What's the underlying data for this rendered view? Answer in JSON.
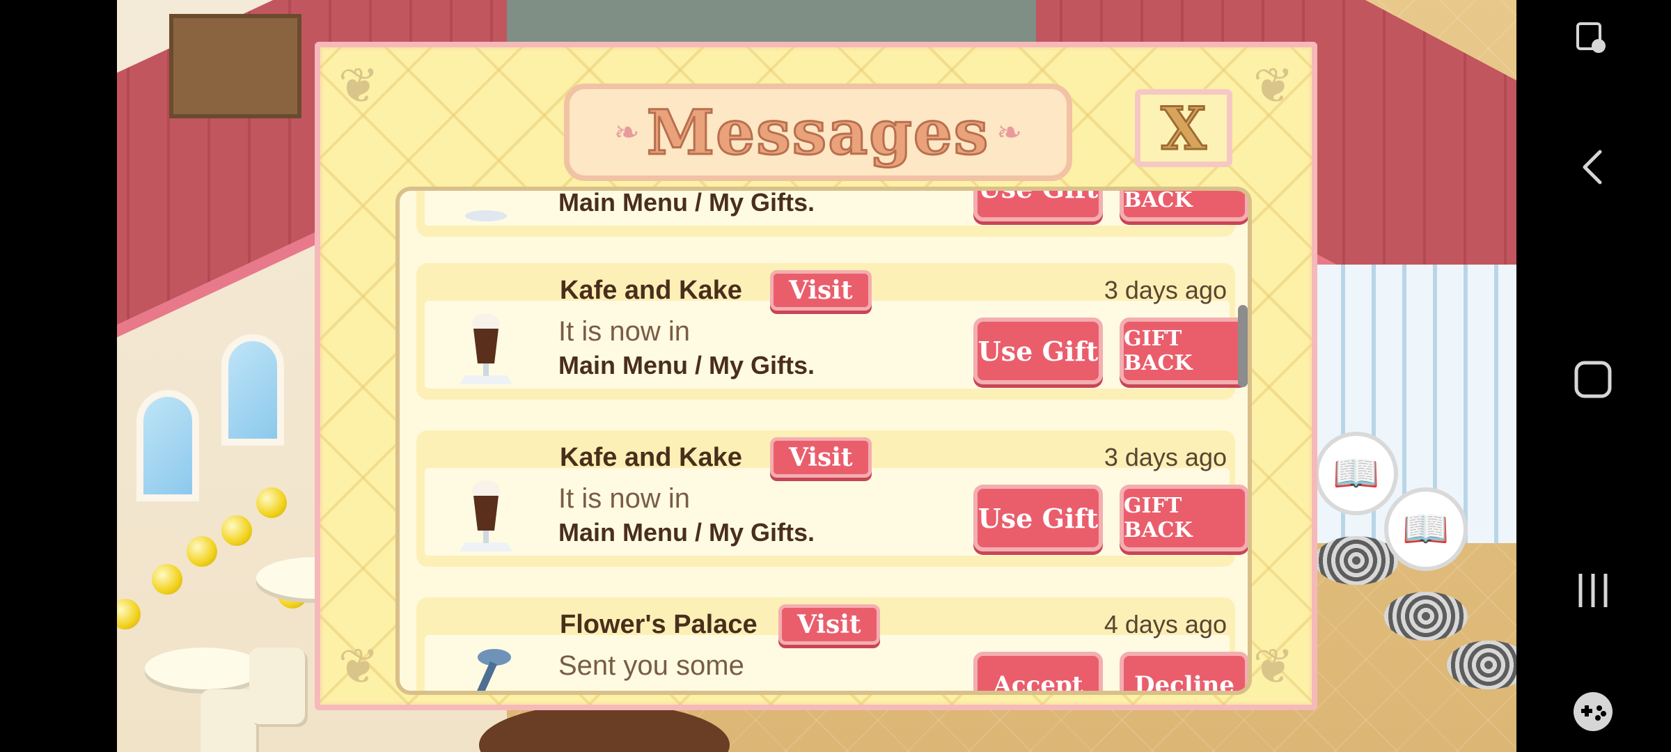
{
  "dialog": {
    "title": "Messages",
    "close_label": "X"
  },
  "messages": [
    {
      "sender": "",
      "time": "",
      "line1": "",
      "line2": "Main Menu / My Gifts.",
      "primary_action": "Use Gift",
      "secondary_action": "GIFT BACK",
      "icon": "gift-icon",
      "partially_visible": true
    },
    {
      "sender": "Kafe and Kake",
      "visit_label": "Visit",
      "time": "3 days ago",
      "line1": "It is now in",
      "line2": "Main Menu / My Gifts.",
      "primary_action": "Use Gift",
      "secondary_action": "GIFT BACK",
      "icon": "iced-coffee-icon"
    },
    {
      "sender": "Kafe and Kake",
      "visit_label": "Visit",
      "time": "3 days ago",
      "line1": "It is now in",
      "line2": "Main Menu / My Gifts.",
      "primary_action": "Use Gift",
      "secondary_action": "GIFT BACK",
      "icon": "iced-coffee-icon"
    },
    {
      "sender": "Flower's Palace",
      "visit_label": "Visit",
      "time": "4 days ago",
      "line1": "Sent you some",
      "primary_action": "Accept",
      "secondary_action": "Decline",
      "icon": "screw-icon",
      "partially_visible": true
    }
  ],
  "navbar": {
    "icons": [
      "screen-touch-icon",
      "back-icon",
      "home-icon",
      "recents-icon",
      "game-launcher-icon"
    ]
  },
  "colors": {
    "button_red": "#ea5e6c",
    "dialog_yellow": "#fcf1a6",
    "text_brown": "#4a2e1c"
  }
}
